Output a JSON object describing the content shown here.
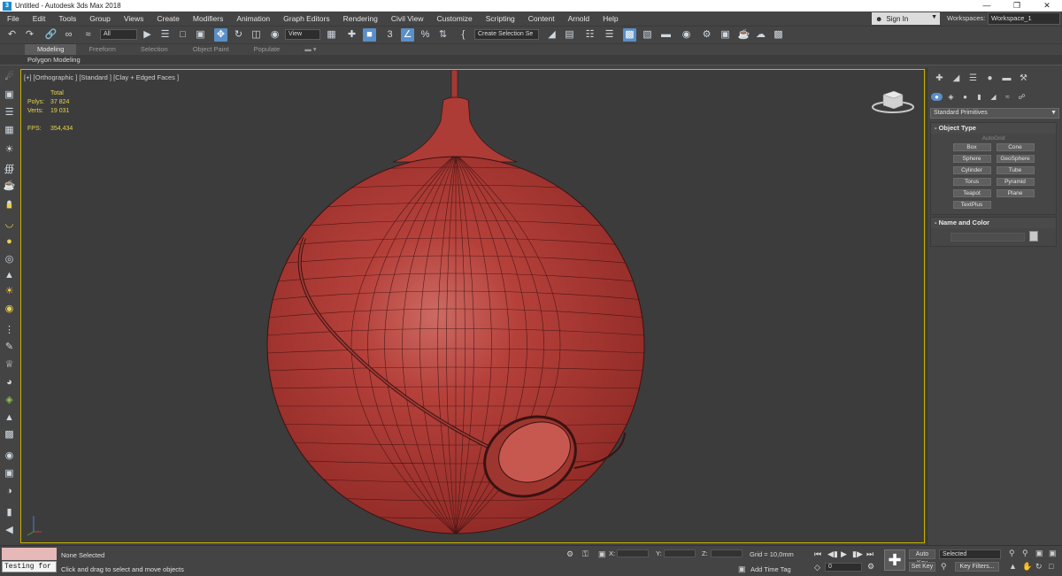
{
  "window": {
    "title": "Untitled - Autodesk 3ds Max 2018",
    "app_icon": "3ds-max-icon",
    "controls": [
      "minimize-icon",
      "restore-icon",
      "close-icon"
    ]
  },
  "menu": [
    "File",
    "Edit",
    "Tools",
    "Group",
    "Views",
    "Create",
    "Modifiers",
    "Animation",
    "Graph Editors",
    "Rendering",
    "Civil View",
    "Customize",
    "Scripting",
    "Content",
    "Arnold",
    "Help"
  ],
  "account": {
    "signin_label": "Sign In",
    "workspaces_label": "Workspaces:",
    "workspace_value": "Workspace_1"
  },
  "toolbar": {
    "selection_filter": "All",
    "ref_coord": "View",
    "selection_set": "Create Selection Se",
    "snaps_label": "3",
    "percent_snap": "%"
  },
  "ribbon": {
    "tabs": [
      "Modeling",
      "Freeform",
      "Selection",
      "Object Paint",
      "Populate"
    ],
    "active_tab": "Modeling",
    "panel_label": "Polygon Modeling"
  },
  "viewport": {
    "label": "[+] [Orthographic ] [Standard ] [Clay + Edged Faces ]",
    "stats": {
      "header": "Total",
      "polys_label": "Polys:",
      "polys_value": "37 824",
      "verts_label": "Verts:",
      "verts_value": "19 031",
      "fps_label": "FPS:",
      "fps_value": "354,434"
    },
    "model_color": "#b5403a",
    "border_color": "#c8b400"
  },
  "command_panel": {
    "primitive_type": "Standard Primitives",
    "object_type_title": "Object Type",
    "autogrid_label": "AutoGrid",
    "object_buttons": [
      "Box",
      "Cone",
      "Sphere",
      "GeoSphere",
      "Cylinder",
      "Tube",
      "Torus",
      "Pyramid",
      "Teapot",
      "Plane",
      "TextPlus"
    ],
    "name_color_title": "Name and Color"
  },
  "status": {
    "maxscript_input": "Testing for :",
    "selection_status": "None Selected",
    "prompt": "Click and drag to select and move objects",
    "x_label": "X:",
    "y_label": "Y:",
    "z_label": "Z:",
    "grid": "Grid = 10,0mm",
    "add_time_tag": "Add Time Tag",
    "frame_value": "0",
    "auto_key": "Auto Key",
    "set_key": "Set Key",
    "key_mode": "Selected",
    "key_filters": "Key Filters..."
  }
}
